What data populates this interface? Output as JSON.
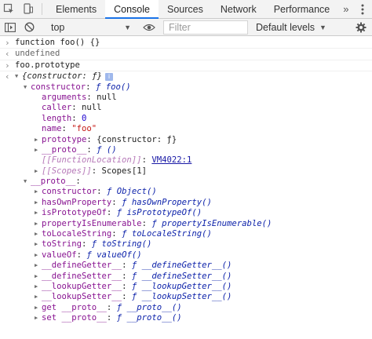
{
  "tabbar": {
    "tabs": [
      "Elements",
      "Console",
      "Sources",
      "Network",
      "Performance"
    ],
    "active_tab": "Console",
    "more": "»"
  },
  "toolbar": {
    "context": "top",
    "filter_placeholder": "Filter",
    "levels": "Default levels"
  },
  "console": {
    "input1": "function foo() {}",
    "result1": "undefined",
    "input2": "foo.prototype",
    "obj_preview": "{constructor: ƒ}",
    "info_badge": "i",
    "tree": {
      "constructor_key": "constructor",
      "constructor_val": "ƒ foo()",
      "arguments_key": "arguments",
      "arguments_val": "null",
      "caller_key": "caller",
      "caller_val": "null",
      "length_key": "length",
      "length_val": "0",
      "name_key": "name",
      "name_val": "\"foo\"",
      "prototype_key": "prototype",
      "prototype_val": "{constructor: ƒ}",
      "proto_key": "__proto__",
      "proto_val": "ƒ ()",
      "location_key": "[[FunctionLocation]]",
      "location_val": "VM4022:1",
      "scopes_key": "[[Scopes]]",
      "scopes_val": "Scopes[1]",
      "obj_proto_key": "__proto__",
      "obj_proto_items": [
        {
          "key": "constructor",
          "val": "ƒ Object()"
        },
        {
          "key": "hasOwnProperty",
          "val": "ƒ hasOwnProperty()"
        },
        {
          "key": "isPrototypeOf",
          "val": "ƒ isPrototypeOf()"
        },
        {
          "key": "propertyIsEnumerable",
          "val": "ƒ propertyIsEnumerable()"
        },
        {
          "key": "toLocaleString",
          "val": "ƒ toLocaleString()"
        },
        {
          "key": "toString",
          "val": "ƒ toString()"
        },
        {
          "key": "valueOf",
          "val": "ƒ valueOf()"
        },
        {
          "key": "__defineGetter__",
          "val": "ƒ __defineGetter__()"
        },
        {
          "key": "__defineSetter__",
          "val": "ƒ __defineSetter__()"
        },
        {
          "key": "__lookupGetter__",
          "val": "ƒ __lookupGetter__()"
        },
        {
          "key": "__lookupSetter__",
          "val": "ƒ __lookupSetter__()"
        },
        {
          "key": "get __proto__",
          "val": "ƒ __proto__()"
        },
        {
          "key": "set __proto__",
          "val": "ƒ __proto__()"
        }
      ]
    }
  },
  "colors": {
    "accent": "#1a73e8",
    "key": "#881391",
    "func": "#0d22aa",
    "number": "#1c00cf",
    "string": "#c41a16"
  }
}
